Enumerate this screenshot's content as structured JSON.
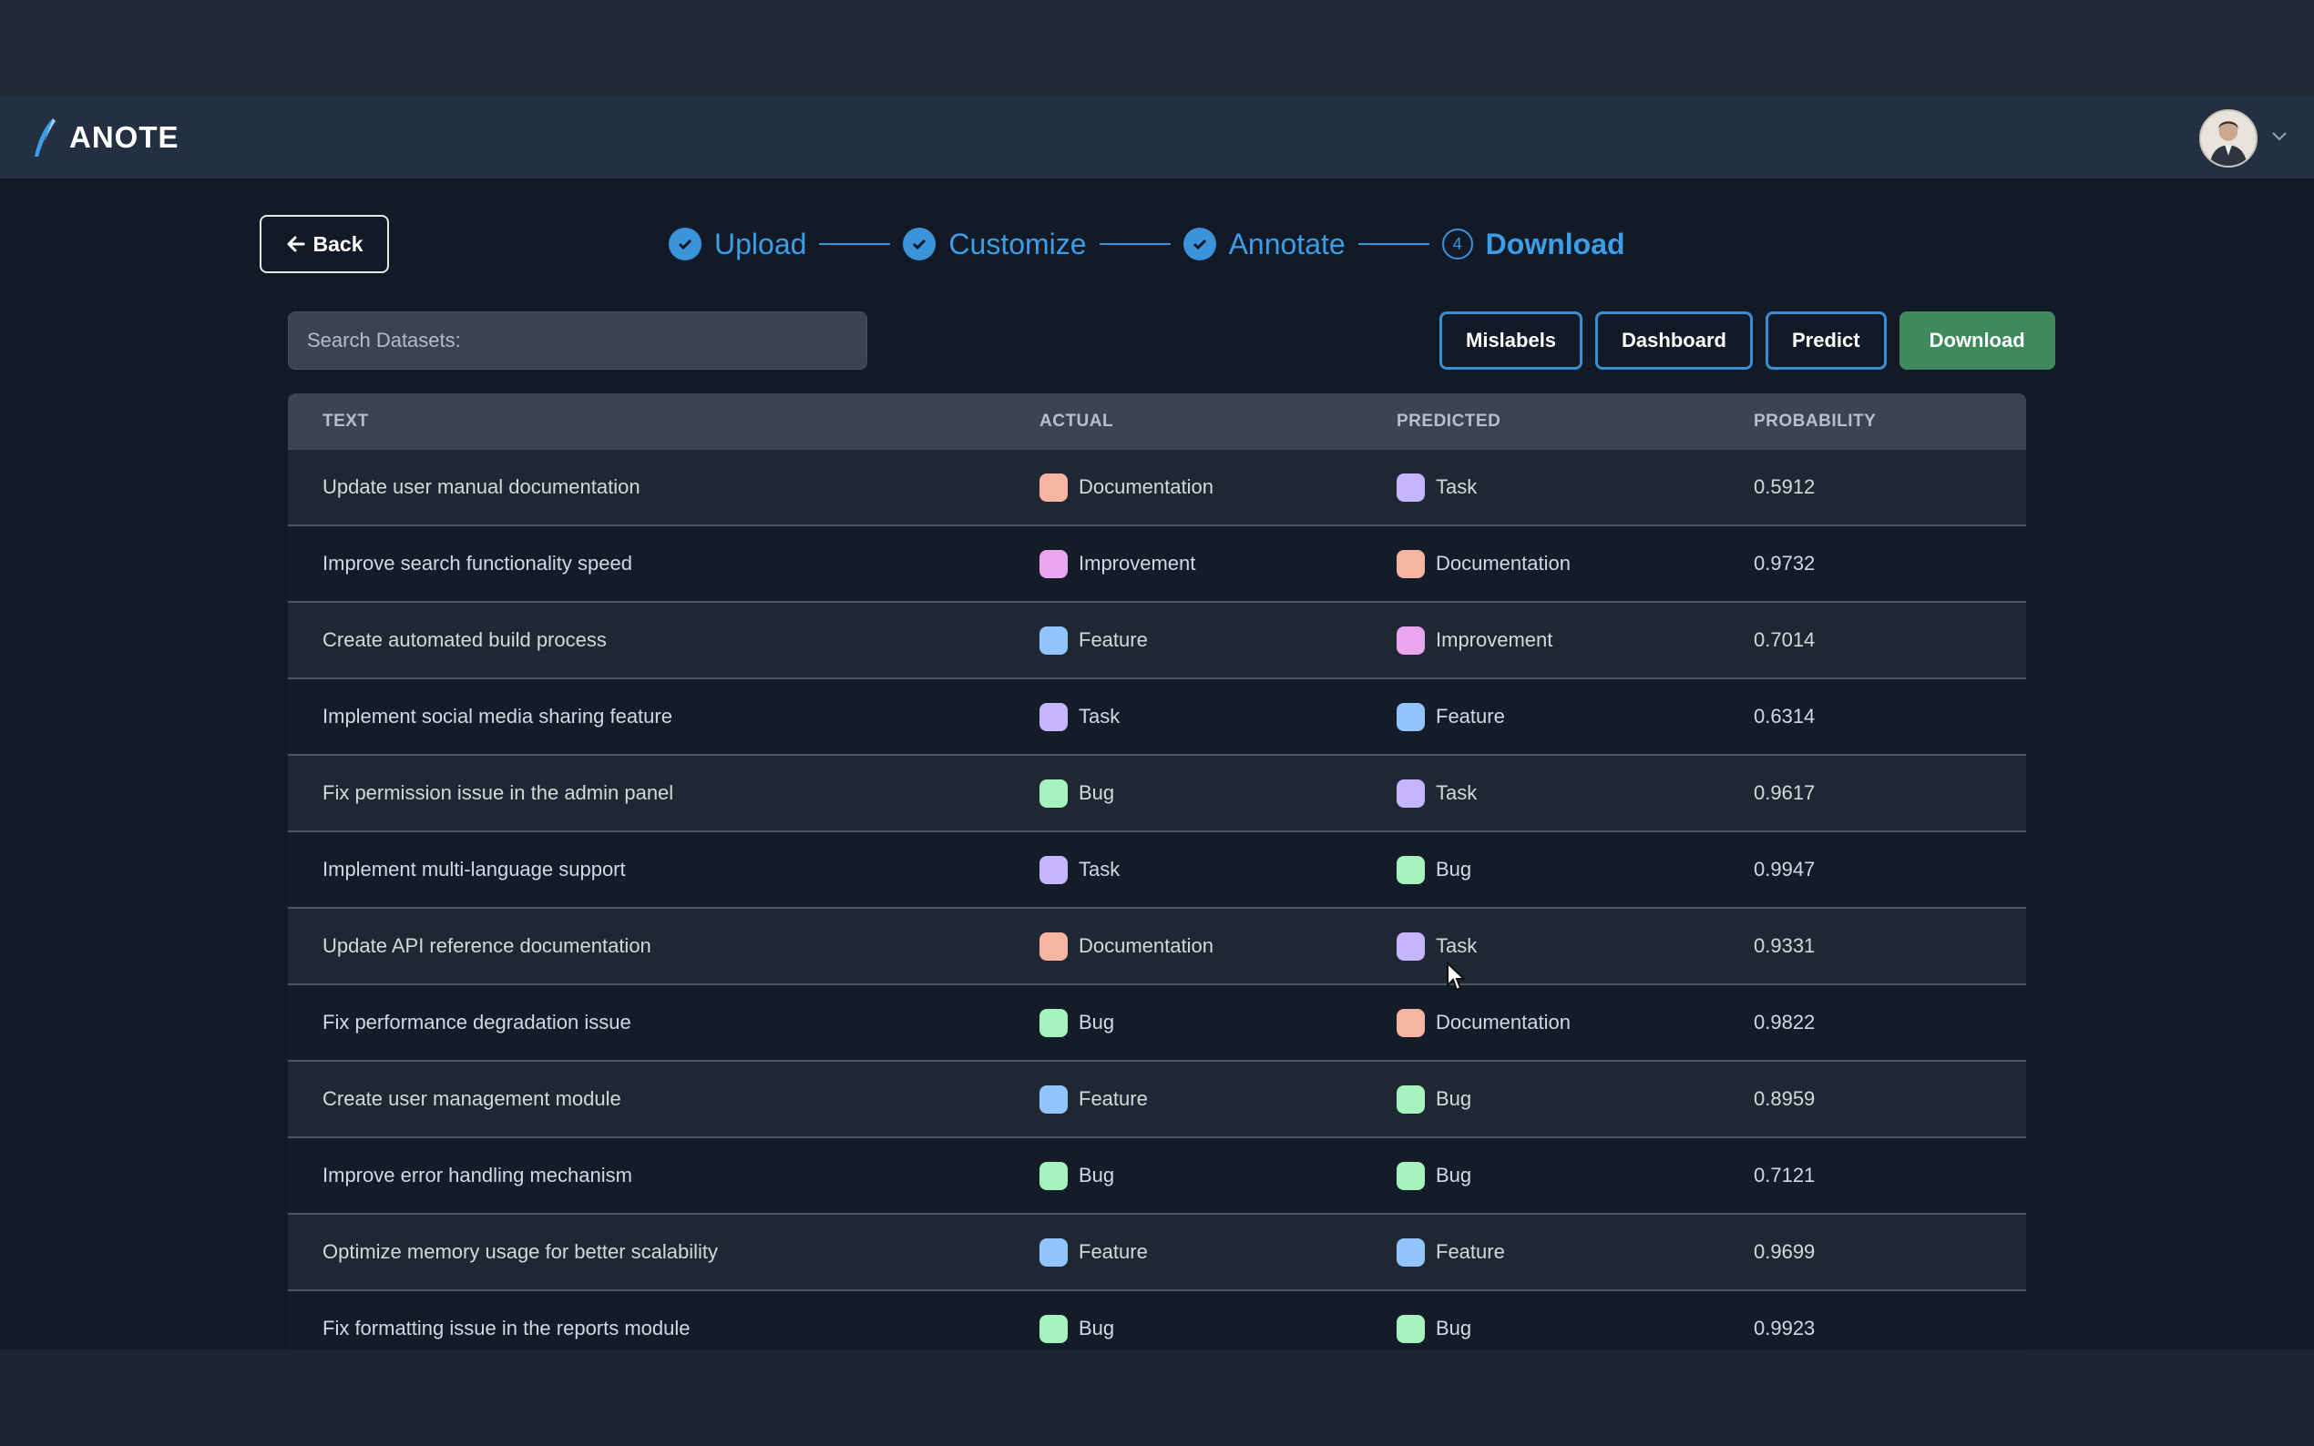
{
  "app": {
    "name": "ANOTE"
  },
  "back": {
    "label": "Back"
  },
  "stepper": [
    {
      "label": "Upload",
      "state": "done"
    },
    {
      "label": "Customize",
      "state": "done"
    },
    {
      "label": "Annotate",
      "state": "done"
    },
    {
      "label": "Download",
      "state": "current",
      "number": "4"
    }
  ],
  "search": {
    "placeholder": "Search Datasets:"
  },
  "actions": {
    "mislabels": "Mislabels",
    "dashboard": "Dashboard",
    "predict": "Predict",
    "download": "Download"
  },
  "table": {
    "headers": {
      "text": "TEXT",
      "actual": "ACTUAL",
      "predicted": "PREDICTED",
      "probability": "PROBABILITY"
    },
    "rows": [
      {
        "text": "Update user manual documentation",
        "actual": "Documentation",
        "predicted": "Task",
        "probability": "0.5912"
      },
      {
        "text": "Improve search functionality speed",
        "actual": "Improvement",
        "predicted": "Documentation",
        "probability": "0.9732"
      },
      {
        "text": "Create automated build process",
        "actual": "Feature",
        "predicted": "Improvement",
        "probability": "0.7014"
      },
      {
        "text": "Implement social media sharing feature",
        "actual": "Task",
        "predicted": "Feature",
        "probability": "0.6314"
      },
      {
        "text": "Fix permission issue in the admin panel",
        "actual": "Bug",
        "predicted": "Task",
        "probability": "0.9617"
      },
      {
        "text": "Implement multi-language support",
        "actual": "Task",
        "predicted": "Bug",
        "probability": "0.9947"
      },
      {
        "text": "Update API reference documentation",
        "actual": "Documentation",
        "predicted": "Task",
        "probability": "0.9331"
      },
      {
        "text": "Fix performance degradation issue",
        "actual": "Bug",
        "predicted": "Documentation",
        "probability": "0.9822"
      },
      {
        "text": "Create user management module",
        "actual": "Feature",
        "predicted": "Bug",
        "probability": "0.8959"
      },
      {
        "text": "Improve error handling mechanism",
        "actual": "Bug",
        "predicted": "Bug",
        "probability": "0.7121"
      },
      {
        "text": "Optimize memory usage for better scalability",
        "actual": "Feature",
        "predicted": "Feature",
        "probability": "0.9699"
      },
      {
        "text": "Fix formatting issue in the reports module",
        "actual": "Bug",
        "predicted": "Bug",
        "probability": "0.9923"
      }
    ]
  },
  "label_colors": {
    "Documentation": "#f8b4a2",
    "Task": "#c4b5fd",
    "Improvement": "#e9a5ee",
    "Feature": "#93c5fd",
    "Bug": "#a7f3c0"
  },
  "colors": {
    "accent": "#3b93dc",
    "download_button": "#3d8a5c"
  }
}
